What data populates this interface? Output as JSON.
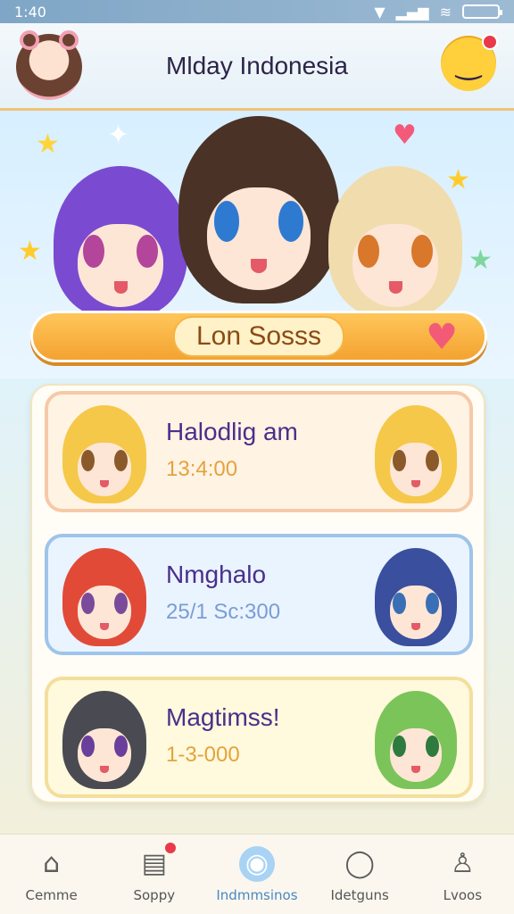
{
  "status_bar": {
    "time": "1:40"
  },
  "header": {
    "title": "Mlday Indonesia"
  },
  "hero": {
    "banner_label": "Lon Sosss"
  },
  "cards": [
    {
      "name": "Halodlig am",
      "time": "13:4:00",
      "accent": "#f6c9a7"
    },
    {
      "name": "Nmghalo",
      "time": "25/1 Sc:300",
      "accent": "#9ec4ea"
    },
    {
      "name": "Magtimss!",
      "time": "1-3-000",
      "accent": "#f3df9b"
    }
  ],
  "nav": {
    "items": [
      {
        "label": "Cemme",
        "icon": "home-icon",
        "active": false
      },
      {
        "label": "Soppy",
        "icon": "calendar-icon",
        "active": false,
        "badge": true
      },
      {
        "label": "Indmmsinos",
        "icon": "chat-icon",
        "active": true
      },
      {
        "label": "Idetguns",
        "icon": "message-icon",
        "active": false
      },
      {
        "label": "Lvoos",
        "icon": "user-icon",
        "active": false
      }
    ]
  }
}
